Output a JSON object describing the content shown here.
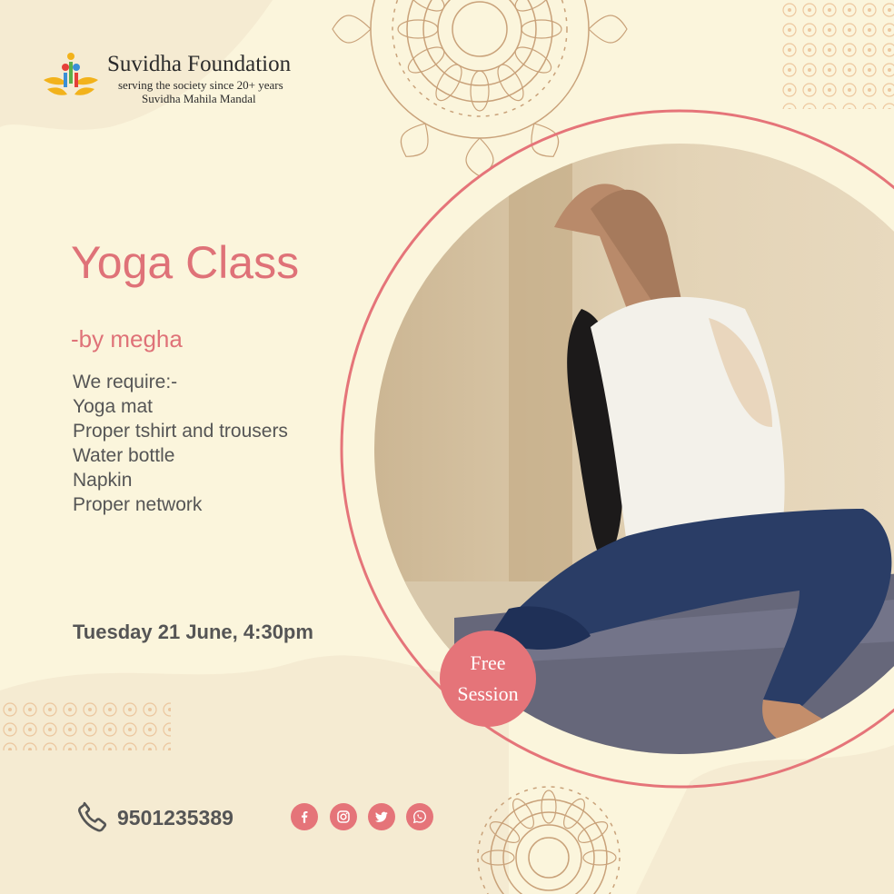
{
  "brand": {
    "name": "Suvidha Foundation",
    "tagline": "serving the society since 20+ years",
    "subtitle": "Suvidha Mahila Mandal"
  },
  "event": {
    "title": "Yoga Class",
    "byline": "-by megha",
    "requirements_heading": "We require:-",
    "requirements": [
      "Yoga mat",
      "Proper tshirt and trousers",
      "Water bottle",
      "Napkin",
      "Proper network"
    ],
    "date_time": "Tuesday 21 June, 4:30pm"
  },
  "badge": {
    "line1": "Free",
    "line2": "Session"
  },
  "contact": {
    "phone": "9501235389"
  },
  "social_icons": [
    "facebook-icon",
    "instagram-icon",
    "twitter-icon",
    "whatsapp-icon"
  ],
  "colors": {
    "background": "#fbf5dc",
    "accent": "#e57479",
    "text_dark": "#555555",
    "ornament": "#c9a27a"
  }
}
